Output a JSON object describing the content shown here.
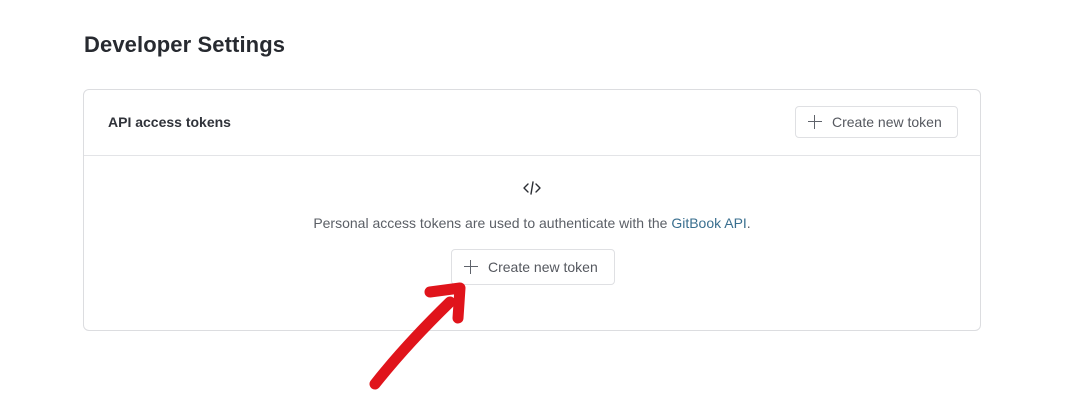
{
  "page": {
    "title": "Developer Settings"
  },
  "tokens_card": {
    "title": "API access tokens",
    "header_button_label": "Create new token",
    "empty_state": {
      "icon": "code-icon",
      "description_prefix": "Personal access tokens are used to authenticate with the ",
      "link_text": "GitBook API",
      "description_suffix": ".",
      "button_label": "Create new token"
    }
  },
  "annotation": {
    "icon": "red-arrow",
    "color": "#e0141b"
  }
}
